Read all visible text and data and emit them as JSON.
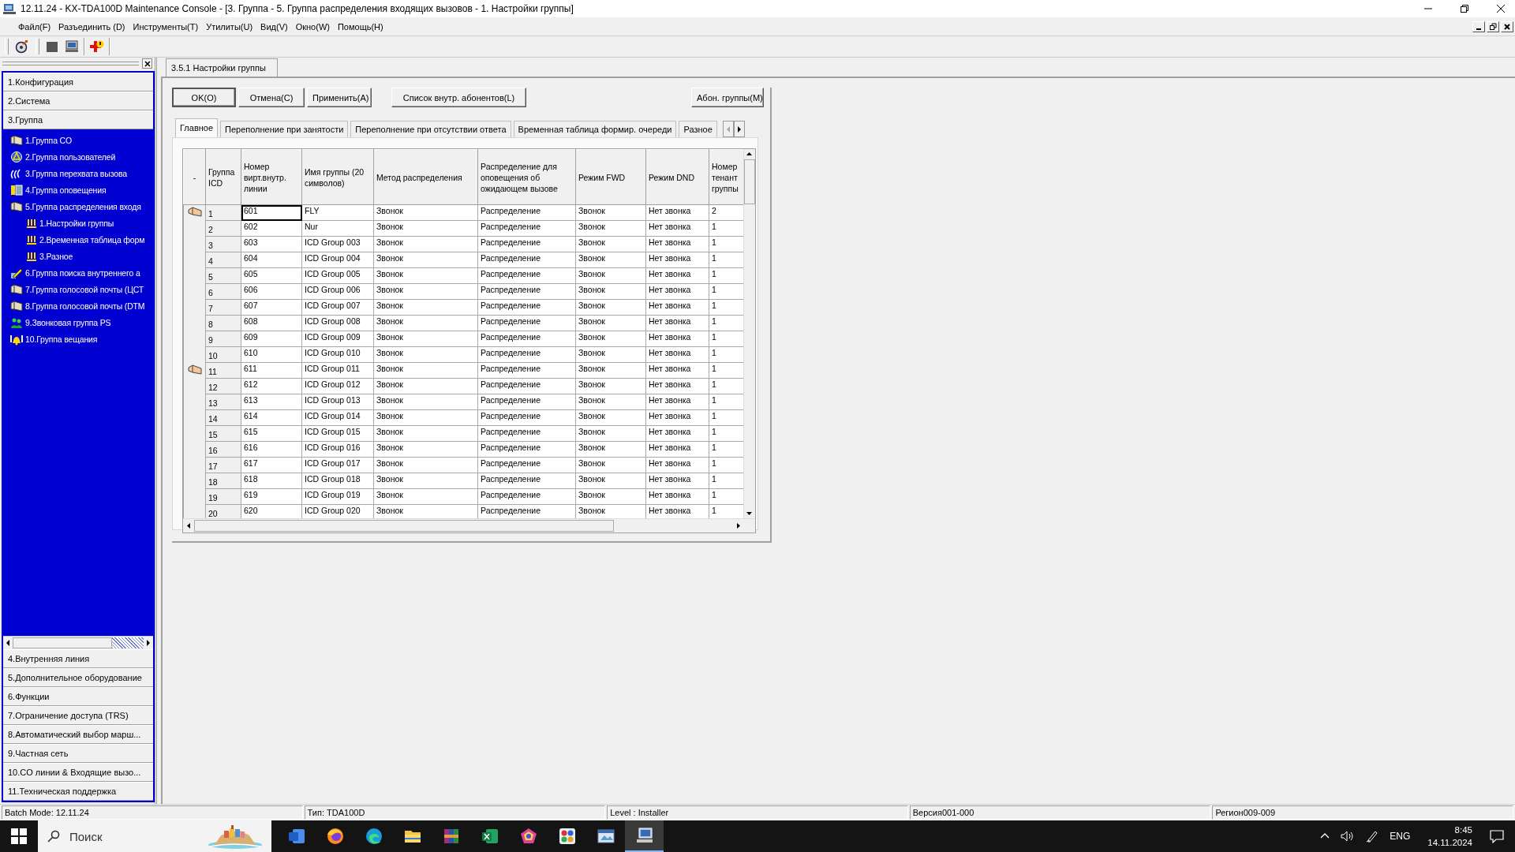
{
  "window": {
    "title": "12.11.24 - KX-TDA100D Maintenance Console - [3. Группа - 5. Группа распределения входящих вызовов - 1. Настройки группы]"
  },
  "menu": [
    "Файл(F)",
    "Разъединить (D)",
    "Инструменты(T)",
    "Утилиты(U)",
    "Вид(V)",
    "Окно(W)",
    "Помощь(H)"
  ],
  "sidebar": {
    "sections": [
      {
        "label": "1.Конфигурация"
      },
      {
        "label": "2.Система"
      },
      {
        "label": "3.Группа",
        "children": [
          {
            "label": "1.Группа CO"
          },
          {
            "label": "2.Группа пользователей"
          },
          {
            "label": "3.Группа перехвата вызова"
          },
          {
            "label": "4.Группа оповещения"
          },
          {
            "label": "5.Группа распределения входя",
            "children": [
              {
                "label": "1.Настройки группы"
              },
              {
                "label": "2.Временная таблица форм"
              },
              {
                "label": "3.Разное"
              }
            ]
          },
          {
            "label": "6.Группа поиска внутреннего а"
          },
          {
            "label": "7.Группа голосовой почты (ЦСТ"
          },
          {
            "label": "8.Группа голосовой почты (DTM"
          },
          {
            "label": "9.Звонковая группа PS"
          },
          {
            "label": "10.Группа вещания"
          }
        ]
      },
      {
        "label": "4.Внутренняя линия"
      },
      {
        "label": "5.Дополнительное оборудование"
      },
      {
        "label": "6.Функции"
      },
      {
        "label": "7.Ограничение доступа (TRS)"
      },
      {
        "label": "8.Автоматический выбор марш..."
      },
      {
        "label": "9.Частная сеть"
      },
      {
        "label": "10.CO линии & Входящие вызо..."
      },
      {
        "label": "11.Техническая поддержка"
      }
    ]
  },
  "document_tab": "3.5.1 Настройки группы",
  "buttons": [
    "OK(O)",
    "Отмена(C)",
    "Применить(A)",
    "Список внутр. абонентов(L)",
    "Абон. группы(M)"
  ],
  "tabs": [
    {
      "label": "Главное",
      "selected": true
    },
    {
      "label": "Переполнение при занятости",
      "selected": false
    },
    {
      "label": "Переполнение при отсутствии ответа",
      "selected": false
    },
    {
      "label": "Временная таблица формир. очереди",
      "selected": false
    },
    {
      "label": "Разное",
      "selected": false
    }
  ],
  "table": {
    "columns": [
      "-",
      "Группа ICD",
      "Номер вирт.внутр. линии",
      "Имя группы (20 символов)",
      "Метод распределения",
      "Распределение для оповещения об ожидающем вызове",
      "Режим FWD",
      "Режим DND",
      "Номер тенант группы"
    ],
    "rows": [
      {
        "marked": true,
        "focused": true,
        "cells": [
          "",
          "1",
          "601",
          "FLY",
          "Звонок",
          "Распределение",
          "Звонок",
          "Нет звонка",
          "2"
        ]
      },
      {
        "marked": false,
        "focused": false,
        "cells": [
          "",
          "2",
          "602",
          "Nur",
          "Звонок",
          "Распределение",
          "Звонок",
          "Нет звонка",
          "1"
        ]
      },
      {
        "marked": false,
        "focused": false,
        "cells": [
          "",
          "3",
          "603",
          "ICD Group 003",
          "Звонок",
          "Распределение",
          "Звонок",
          "Нет звонка",
          "1"
        ]
      },
      {
        "marked": false,
        "focused": false,
        "cells": [
          "",
          "4",
          "604",
          "ICD Group 004",
          "Звонок",
          "Распределение",
          "Звонок",
          "Нет звонка",
          "1"
        ]
      },
      {
        "marked": false,
        "focused": false,
        "cells": [
          "",
          "5",
          "605",
          "ICD Group 005",
          "Звонок",
          "Распределение",
          "Звонок",
          "Нет звонка",
          "1"
        ]
      },
      {
        "marked": false,
        "focused": false,
        "cells": [
          "",
          "6",
          "606",
          "ICD Group 006",
          "Звонок",
          "Распределение",
          "Звонок",
          "Нет звонка",
          "1"
        ]
      },
      {
        "marked": false,
        "focused": false,
        "cells": [
          "",
          "7",
          "607",
          "ICD Group 007",
          "Звонок",
          "Распределение",
          "Звонок",
          "Нет звонка",
          "1"
        ]
      },
      {
        "marked": false,
        "focused": false,
        "cells": [
          "",
          "8",
          "608",
          "ICD Group 008",
          "Звонок",
          "Распределение",
          "Звонок",
          "Нет звонка",
          "1"
        ]
      },
      {
        "marked": false,
        "focused": false,
        "cells": [
          "",
          "9",
          "609",
          "ICD Group 009",
          "Звонок",
          "Распределение",
          "Звонок",
          "Нет звонка",
          "1"
        ]
      },
      {
        "marked": false,
        "focused": false,
        "cells": [
          "",
          "10",
          "610",
          "ICD Group 010",
          "Звонок",
          "Распределение",
          "Звонок",
          "Нет звонка",
          "1"
        ]
      },
      {
        "marked": true,
        "focused": false,
        "cells": [
          "",
          "11",
          "611",
          "ICD Group 011",
          "Звонок",
          "Распределение",
          "Звонок",
          "Нет звонка",
          "1"
        ]
      },
      {
        "marked": false,
        "focused": false,
        "cells": [
          "",
          "12",
          "612",
          "ICD Group 012",
          "Звонок",
          "Распределение",
          "Звонок",
          "Нет звонка",
          "1"
        ]
      },
      {
        "marked": false,
        "focused": false,
        "cells": [
          "",
          "13",
          "613",
          "ICD Group 013",
          "Звонок",
          "Распределение",
          "Звонок",
          "Нет звонка",
          "1"
        ]
      },
      {
        "marked": false,
        "focused": false,
        "cells": [
          "",
          "14",
          "614",
          "ICD Group 014",
          "Звонок",
          "Распределение",
          "Звонок",
          "Нет звонка",
          "1"
        ]
      },
      {
        "marked": false,
        "focused": false,
        "cells": [
          "",
          "15",
          "615",
          "ICD Group 015",
          "Звонок",
          "Распределение",
          "Звонок",
          "Нет звонка",
          "1"
        ]
      },
      {
        "marked": false,
        "focused": false,
        "cells": [
          "",
          "16",
          "616",
          "ICD Group 016",
          "Звонок",
          "Распределение",
          "Звонок",
          "Нет звонка",
          "1"
        ]
      },
      {
        "marked": false,
        "focused": false,
        "cells": [
          "",
          "17",
          "617",
          "ICD Group 017",
          "Звонок",
          "Распределение",
          "Звонок",
          "Нет звонка",
          "1"
        ]
      },
      {
        "marked": false,
        "focused": false,
        "cells": [
          "",
          "18",
          "618",
          "ICD Group 018",
          "Звонок",
          "Распределение",
          "Звонок",
          "Нет звонка",
          "1"
        ]
      },
      {
        "marked": false,
        "focused": false,
        "cells": [
          "",
          "19",
          "619",
          "ICD Group 019",
          "Звонок",
          "Распределение",
          "Звонок",
          "Нет звонка",
          "1"
        ]
      },
      {
        "marked": false,
        "focused": false,
        "cells": [
          "",
          "20",
          "620",
          "ICD Group 020",
          "Звонок",
          "Распределение",
          "Звонок",
          "Нет звонка",
          "1"
        ]
      }
    ]
  },
  "status_bar": [
    "Batch Mode: 12.11.24",
    "Тип: TDA100D",
    "Level : Installer",
    "Версия001-000",
    "Регион009-009"
  ],
  "taskbar": {
    "search_placeholder": "Поиск",
    "apps": [
      {
        "active": false
      },
      {
        "active": false
      },
      {
        "active": false
      },
      {
        "active": false
      },
      {
        "active": false
      },
      {
        "active": false
      },
      {
        "active": false
      },
      {
        "active": false
      },
      {
        "active": false
      },
      {
        "active": true
      }
    ],
    "language": "ENG",
    "time": "8:45",
    "date": "14.11.2024"
  }
}
